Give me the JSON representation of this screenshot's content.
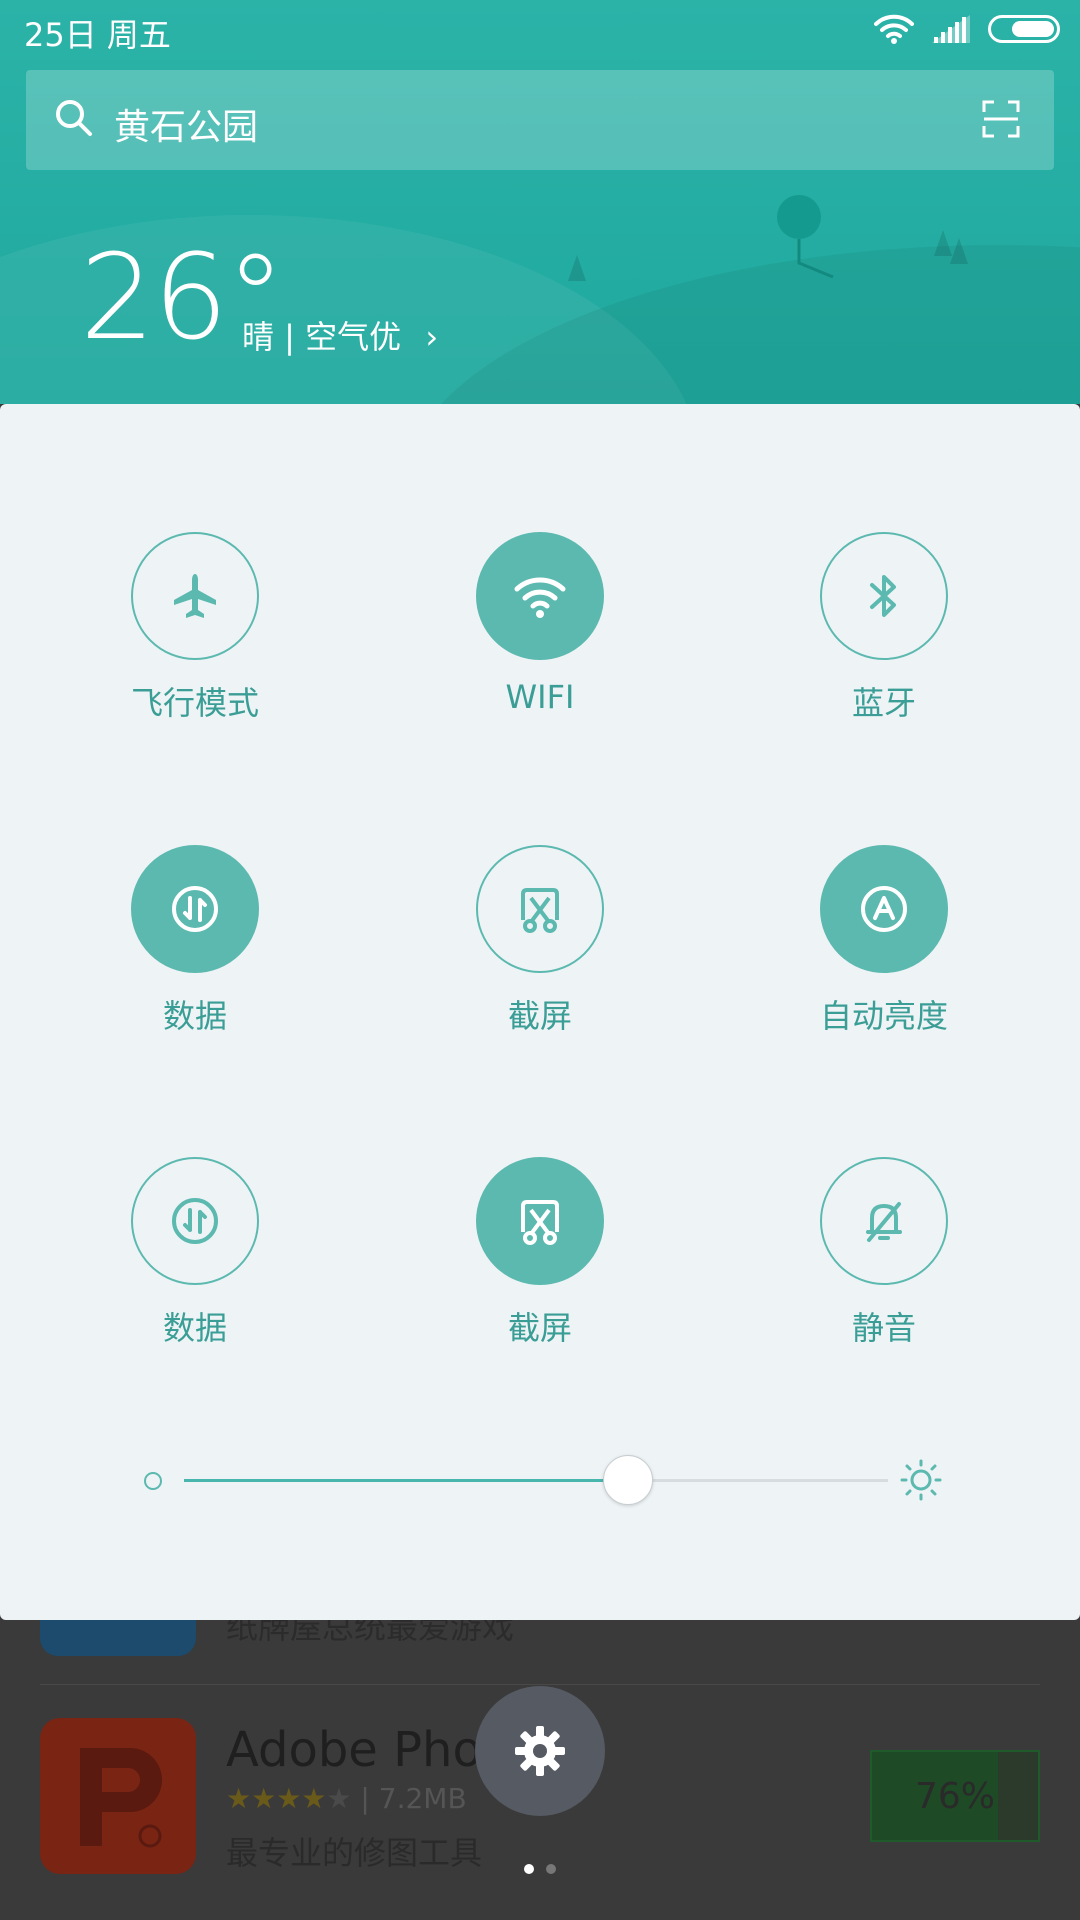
{
  "status_bar": {
    "time": "25日 周五"
  },
  "search": {
    "query": "黄石公园"
  },
  "weather": {
    "temperature": "26°",
    "description": "晴 | 空气优",
    "chevron": "›"
  },
  "toggles": [
    {
      "label": "飞行模式",
      "icon": "airplane-icon",
      "on": false
    },
    {
      "label": "WIFI",
      "icon": "wifi-icon",
      "on": true
    },
    {
      "label": "蓝牙",
      "icon": "bluetooth-icon",
      "on": false
    },
    {
      "label": "数据",
      "icon": "data-icon",
      "on": true
    },
    {
      "label": "截屏",
      "icon": "screenshot-icon",
      "on": false
    },
    {
      "label": "自动亮度",
      "icon": "auto-brightness-icon",
      "on": true
    },
    {
      "label": "数据",
      "icon": "data-icon",
      "on": false
    },
    {
      "label": "截屏",
      "icon": "screenshot-icon",
      "on": true
    },
    {
      "label": "静音",
      "icon": "mute-icon",
      "on": false
    }
  ],
  "brightness": {
    "level": 0.63
  },
  "background_apps": {
    "prev_desc": "纸牌屋总统最爱游戏",
    "app_name": "Adobe Photo",
    "stars": "★★★★",
    "star_empty": "★",
    "size": " | 7.2MB",
    "desc": "最专业的修图工具",
    "progress": "76%",
    "progress_value": 0.76
  },
  "pager": {
    "pages": 2,
    "active": 0
  },
  "colors": {
    "header": "#2bb3a8",
    "accent": "#5cb9b0",
    "panel": "#eef3f5"
  }
}
